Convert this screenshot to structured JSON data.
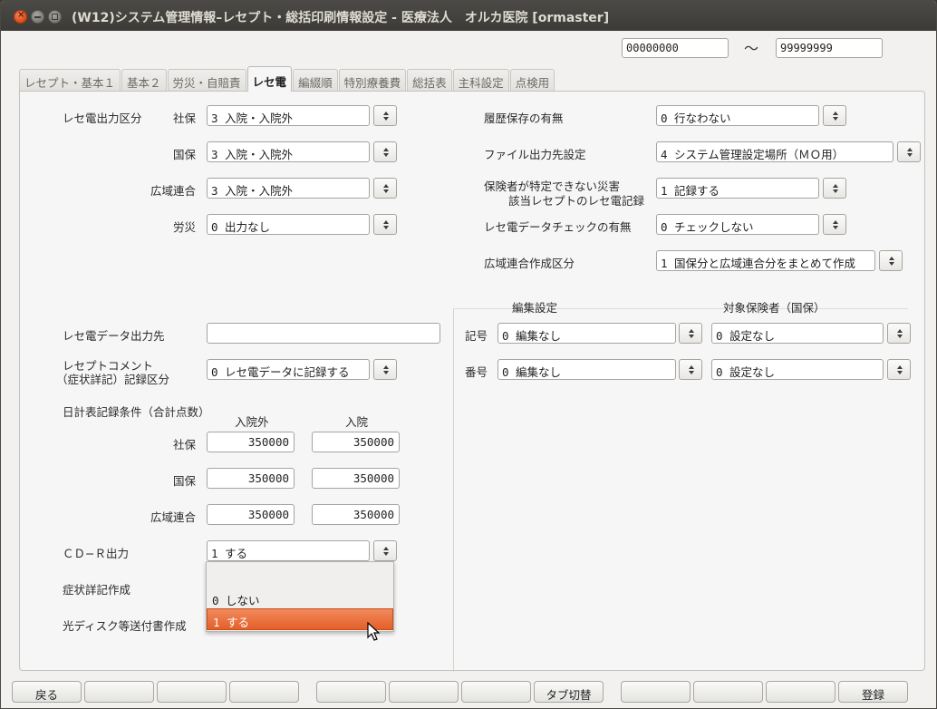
{
  "window": {
    "title": "(W12)システム管理情報–レセプト・総括印刷情報設定 - 医療法人　オルカ医院  [ormaster]",
    "close_glyph": "×"
  },
  "range": {
    "from": "00000000",
    "tilde": "～",
    "to": "99999999"
  },
  "tabs": [
    {
      "label": "レセプト・基本１",
      "active": false
    },
    {
      "label": "基本２",
      "active": false
    },
    {
      "label": "労災・自賠責",
      "active": false
    },
    {
      "label": "レセ電",
      "active": true
    },
    {
      "label": "編綴順",
      "active": false
    },
    {
      "label": "特別療養費",
      "active": false
    },
    {
      "label": "総括表",
      "active": false
    },
    {
      "label": "主科設定",
      "active": false
    },
    {
      "label": "点検用",
      "active": false
    }
  ],
  "left": {
    "output_section_label": "レセ電出力区分",
    "output_rows": [
      {
        "label": "社保",
        "value": "3 入院・入院外"
      },
      {
        "label": "国保",
        "value": "3 入院・入院外"
      },
      {
        "label": "広域連合",
        "value": "3 入院・入院外"
      },
      {
        "label": "労災",
        "value": "0 出力なし"
      }
    ],
    "data_dest_label": "レセ電データ出力先",
    "data_dest_value": "",
    "comment_label_1": "レセプトコメント",
    "comment_label_2": "（症状詳記）記録区分",
    "comment_value": "0 レセ電データに記録する",
    "daily_label": "日計表記録条件（合計点数）",
    "daily_col_outpatient": "入院外",
    "daily_col_inpatient": "入院",
    "daily_rows": [
      {
        "label": "社保",
        "outpatient": "350000",
        "inpatient": "350000"
      },
      {
        "label": "国保",
        "outpatient": "350000",
        "inpatient": "350000"
      },
      {
        "label": "広域連合",
        "outpatient": "350000",
        "inpatient": "350000"
      }
    ],
    "cdr_label": "ＣＤ−Ｒ出力",
    "cdr_value": "1 する",
    "symptom_label": "症状詳記作成",
    "optical_label": "光ディスク等送付書作成"
  },
  "dropdown": {
    "options": [
      "",
      "0 しない",
      "1 する"
    ],
    "selected": "1 する"
  },
  "right": {
    "history_label": "履歴保存の有無",
    "history_value": "0 行なわない",
    "file_dest_label": "ファイル出力先設定",
    "file_dest_value": "4 システム管理設定場所（ＭＯ用）",
    "disaster_label_1": "保険者が特定できない災害",
    "disaster_label_2": "該当レセプトのレセ電記録",
    "disaster_value": "1 記録する",
    "check_label": "レセ電データチェックの有無",
    "check_value": "0 チェックしない",
    "koiki_label": "広域連合作成区分",
    "koiki_value": "1 国保分と広域連合分をまとめて作成",
    "edit_header": "編集設定",
    "insurer_header": "対象保険者（国保）",
    "rows": [
      {
        "label": "記号",
        "edit": "0 編集なし",
        "insurer": "0 設定なし"
      },
      {
        "label": "番号",
        "edit": "0 編集なし",
        "insurer": "0 設定なし"
      }
    ]
  },
  "footer": {
    "buttons": [
      "戻る",
      "",
      "",
      "",
      "",
      "",
      "",
      "タブ切替",
      "",
      "",
      "",
      "登録"
    ]
  }
}
